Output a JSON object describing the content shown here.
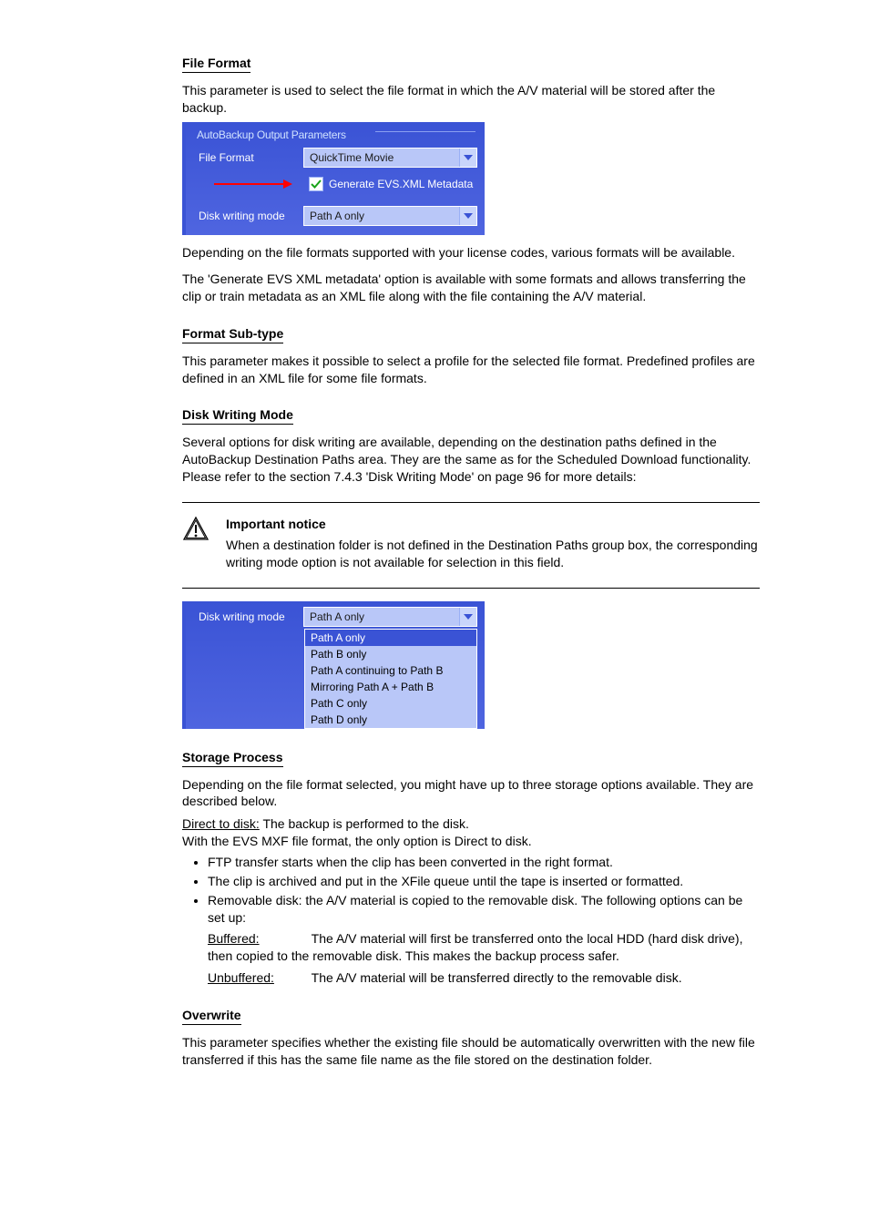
{
  "doc": {
    "heading_file_format": "File Format",
    "file_format_p1": "This parameter is used to select the file format in which the A/V material will be stored after the backup.",
    "file_format_p2": "Depending on the file formats supported with your license codes, various formats will be available.",
    "file_format_p3": "The 'Generate EVS XML metadata' option is available with some formats and allows transferring the clip or train metadata as an XML file along with the file containing the A/V material.",
    "heading_format_subtype": "Format Sub-type",
    "format_subtype_p1": "This parameter makes it possible to select a profile for the selected file format. Predefined profiles are defined in an XML file for some file formats.",
    "heading_disk_writing": "Disk Writing Mode",
    "disk_writing_p1": "Several options for disk writing are available, depending on the destination paths defined in the AutoBackup Destination Paths area. They are the same as for the Scheduled Download functionality. Please refer to the section 7.4.3 'Disk Writing Mode' on page 96 for more details:",
    "notice": {
      "title": "Important notice",
      "body": "When a destination folder is not defined in the Destination Paths group box, the corresponding writing mode option is not available for selection in this field."
    },
    "heading_storage_process": "Storage Process",
    "storage_intro": "Depending on the file format selected, you might have up to three storage options available. They are described below.",
    "storage_direct_label": "Direct to disk:",
    "storage_direct_text": " The backup is performed to the disk.",
    "storage_direct_note": "With the EVS MXF file format, the only option is Direct to disk.",
    "bullet_ftp": "FTP transfer starts when the clip has been converted in the right format.",
    "bullet_archive": "The clip is archived and put in the XFile queue until the tape is inserted or formatted.",
    "bullet_removable": "Removable disk: the A/V material is copied to the removable disk. The following options can be set up:",
    "buffered_label": "Buffered:",
    "buffered_text": " The A/V material will first be transferred onto the local HDD (hard disk drive), then copied to the removable disk. This makes the backup process safer.",
    "unbuffered_label": "Unbuffered:",
    "unbuffered_text": " The A/V material will be transferred directly to the removable disk.",
    "heading_overwrite": "Overwrite",
    "overwrite_p1": "This parameter specifies whether the existing file should be automatically overwritten with the new file transferred if this has the same file name as the file stored on the destination folder."
  },
  "panel1": {
    "legend": "AutoBackup Output Parameters",
    "file_format_label": "File Format",
    "file_format_value": "QuickTime Movie",
    "checkbox_label": "Generate EVS.XML Metadata",
    "disk_mode_label": "Disk writing mode",
    "disk_mode_value": "Path A only"
  },
  "panel2": {
    "disk_mode_label": "Disk writing mode",
    "disk_mode_value": "Path A only",
    "options": [
      "Path A only",
      "Path B only",
      "Path A continuing to Path B",
      "Mirroring Path A + Path B",
      "Path C only",
      "Path D only"
    ]
  }
}
